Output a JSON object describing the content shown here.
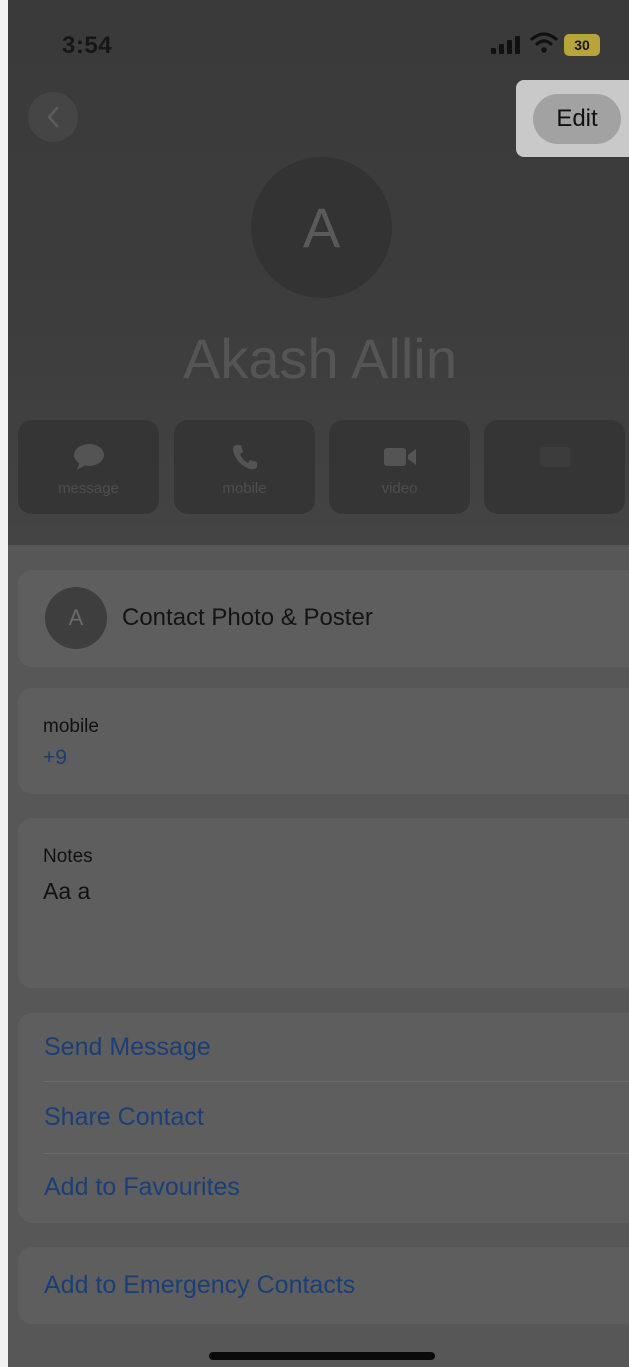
{
  "status_bar": {
    "time": "3:54",
    "battery": "30"
  },
  "nav": {
    "edit_label": "Edit"
  },
  "contact": {
    "initial": "A",
    "name": "Akash Allin"
  },
  "actions": [
    {
      "label": "message",
      "icon": "message-bubble-icon"
    },
    {
      "label": "mobile",
      "icon": "phone-icon"
    },
    {
      "label": "video",
      "icon": "video-camera-icon"
    },
    {
      "label": "",
      "icon": "mail-icon"
    }
  ],
  "photo_card": {
    "initial": "A",
    "label": "Contact Photo & Poster"
  },
  "mobile_card": {
    "label": "mobile",
    "value": "+9"
  },
  "notes_card": {
    "label": "Notes",
    "value": "Aa a"
  },
  "links": [
    "Send Message",
    "Share Contact",
    "Add to Favourites"
  ],
  "emergency": {
    "label": "Add to Emergency Contacts"
  },
  "colors": {
    "link": "#1a3f78",
    "highlight": "#c9c9c9"
  }
}
